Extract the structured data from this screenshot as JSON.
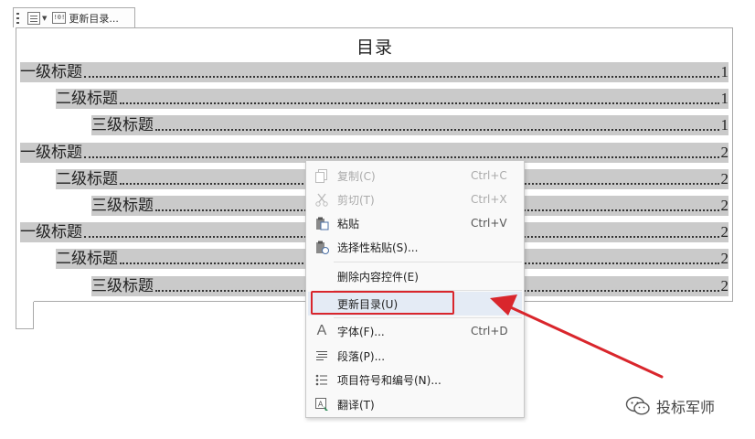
{
  "content_control": {
    "update_label": "更新目录...",
    "update_glyph": "!0!"
  },
  "toc": {
    "heading": "目录",
    "entries": [
      {
        "text": "一级标题",
        "page": "1",
        "level": 1
      },
      {
        "text": "二级标题",
        "page": "1",
        "level": 2
      },
      {
        "text": "三级标题",
        "page": "1",
        "level": 3
      },
      {
        "text": "一级标题",
        "page": "2",
        "level": 1
      },
      {
        "text": "二级标题",
        "page": "2",
        "level": 2
      },
      {
        "text": "三级标题",
        "page": "2",
        "level": 3
      },
      {
        "text": "一级标题",
        "page": "2",
        "level": 1
      },
      {
        "text": "二级标题",
        "page": "2",
        "level": 2
      },
      {
        "text": "三级标题",
        "page": "2",
        "level": 3
      }
    ]
  },
  "context_menu": {
    "items": [
      {
        "label": "复制(C)",
        "shortcut": "Ctrl+C",
        "icon": "copy-icon",
        "disabled": true
      },
      {
        "label": "剪切(T)",
        "shortcut": "Ctrl+X",
        "icon": "scissors-icon",
        "disabled": true
      },
      {
        "label": "粘贴",
        "shortcut": "Ctrl+V",
        "icon": "paste-icon",
        "disabled": false
      },
      {
        "label": "选择性粘贴(S)...",
        "shortcut": "",
        "icon": "paste-special-icon",
        "disabled": false
      },
      {
        "label": "删除内容控件(E)",
        "shortcut": "",
        "icon": "",
        "disabled": false
      },
      {
        "label": "更新目录(U)",
        "shortcut": "",
        "icon": "",
        "disabled": false,
        "highlighted": true
      },
      {
        "label": "字体(F)...",
        "shortcut": "Ctrl+D",
        "icon": "font-icon",
        "disabled": false
      },
      {
        "label": "段落(P)...",
        "shortcut": "",
        "icon": "paragraph-icon",
        "disabled": false
      },
      {
        "label": "项目符号和编号(N)...",
        "shortcut": "",
        "icon": "bullet-list-icon",
        "disabled": false
      },
      {
        "label": "翻译(T)",
        "shortcut": "",
        "icon": "translate-icon",
        "disabled": false
      }
    ]
  },
  "annotation": {
    "color": "#d9262c"
  },
  "watermark": {
    "text": "投标军师"
  }
}
